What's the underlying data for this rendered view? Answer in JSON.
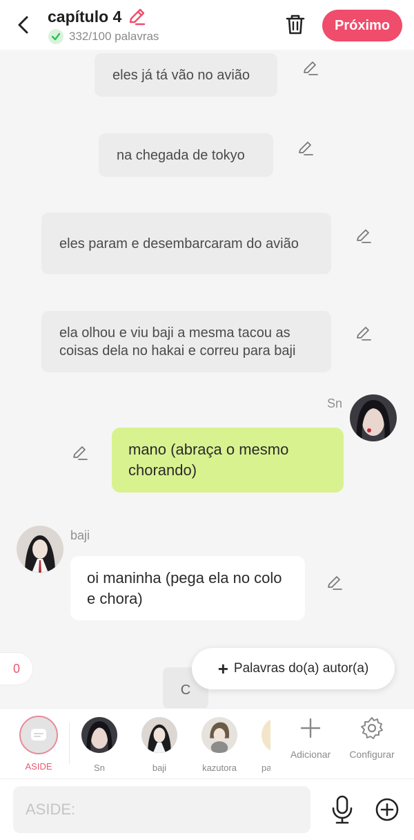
{
  "header": {
    "title": "capítulo 4",
    "word_count": "332/100 palavras",
    "next_label": "Próximo"
  },
  "chat": {
    "narrations": [
      "eles já tá vão no avião",
      "na chegada de tokyo",
      "eles param e desembarcaram do avião",
      "ela olhou e viu baji a mesma tacou as coisas dela no hakai e correu para baji"
    ],
    "messages": [
      {
        "name": "Sn",
        "text": "mano (abraça o mesmo chorando)"
      },
      {
        "name": "baji",
        "text": "oi maninha (pega ela no colo e chora)"
      }
    ],
    "counter": "0",
    "author_words_label": "Palavras do(a) autor(a)",
    "partial_text": "C"
  },
  "charbar": {
    "characters": [
      {
        "label": "ASIDE"
      },
      {
        "label": "Sn"
      },
      {
        "label": "baji"
      },
      {
        "label": "kazutora"
      },
      {
        "label": "pa"
      }
    ],
    "add_label": "Adicionar",
    "settings_label": "Configurar"
  },
  "input": {
    "placeholder": "ASIDE:"
  },
  "colors": {
    "accent": "#f04c6b",
    "user_bubble": "#d9f290",
    "narration_bg": "#ececec"
  },
  "icons": [
    "back-arrow-icon",
    "pencil-icon",
    "check-icon",
    "trash-icon",
    "plus-icon",
    "gear-icon",
    "mic-icon",
    "plus-circle-icon",
    "aside-chat-icon"
  ]
}
